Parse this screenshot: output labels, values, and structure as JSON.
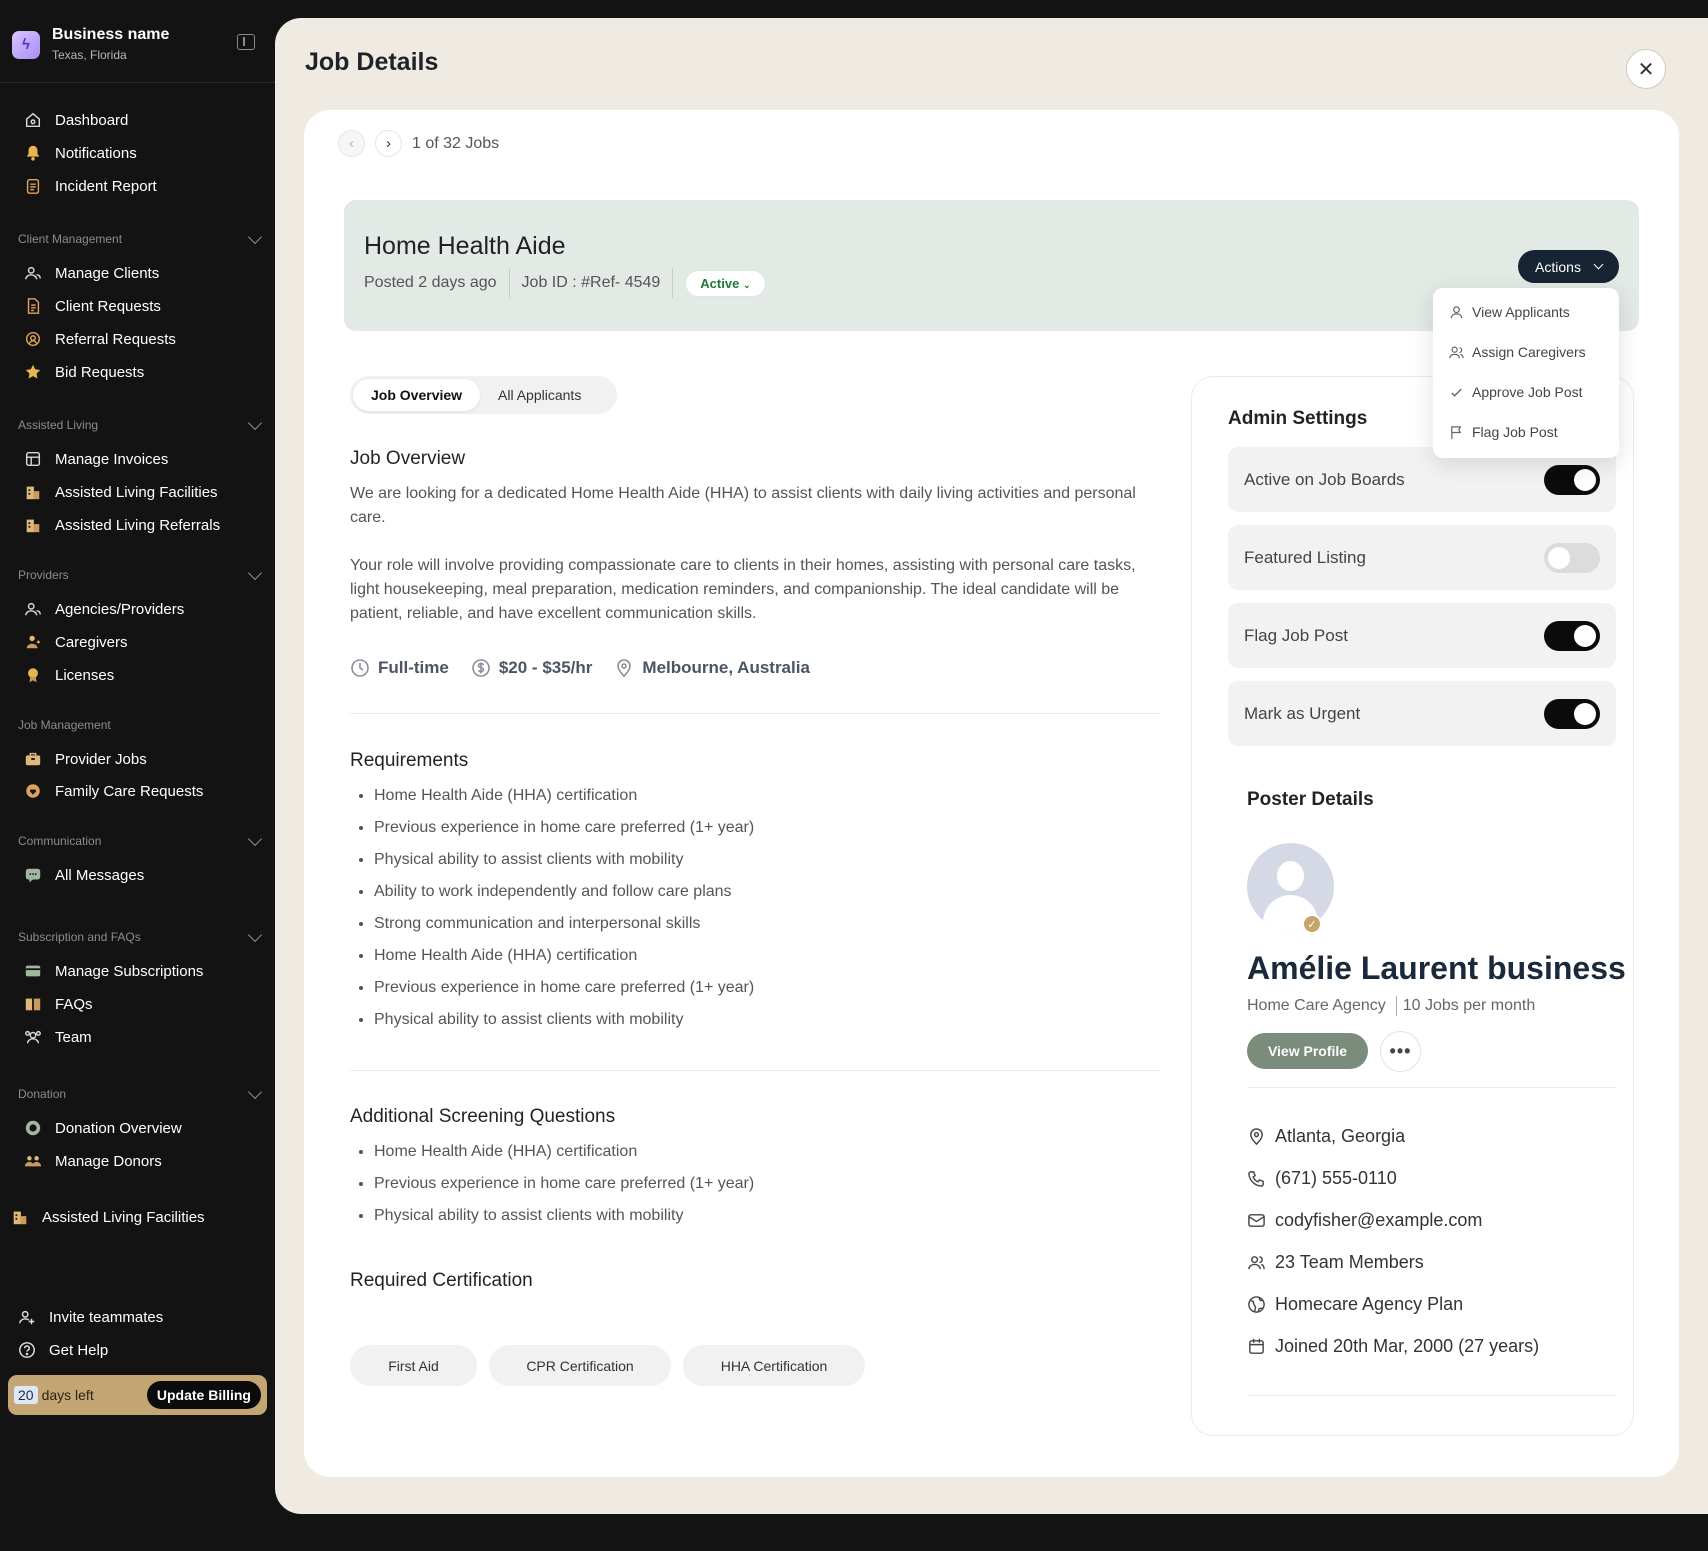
{
  "business": {
    "name": "Business name",
    "location": "Texas, Florida"
  },
  "nav": {
    "top": [
      "Dashboard",
      "Notifications",
      "Incident Report"
    ],
    "sections": [
      {
        "title": "Client Management",
        "items": [
          "Manage Clients",
          "Client Requests",
          "Referral Requests",
          "Bid Requests"
        ]
      },
      {
        "title": "Assisted Living",
        "items": [
          "Manage Invoices",
          "Assisted Living Facilities",
          "Assisted Living Referrals"
        ]
      },
      {
        "title": "Providers",
        "items": [
          "Agencies/Providers",
          "Caregivers",
          "Licenses"
        ]
      },
      {
        "title": "Job Management",
        "items": [
          "Provider Jobs",
          "Family Care Requests"
        ]
      },
      {
        "title": "Communication",
        "items": [
          "All Messages"
        ]
      },
      {
        "title": "Subscription and FAQs",
        "items": [
          "Manage Subscriptions",
          "FAQs",
          "Team"
        ]
      },
      {
        "title": "Donation",
        "items": [
          "Donation Overview",
          "Manage Donors"
        ]
      }
    ],
    "extra_item": "Assisted Living Facilities",
    "invite": "Invite teammates",
    "help": "Get Help"
  },
  "billing": {
    "days": "20",
    "days_label": "days left",
    "button": "Update Billing"
  },
  "page": {
    "title": "Job Details"
  },
  "pager": {
    "text": "1 of 32 Jobs"
  },
  "job": {
    "title": "Home Health Aide",
    "posted": "Posted 2 days ago",
    "job_id": "Job ID : #Ref- 4549",
    "status": "Active",
    "actions_label": "Actions"
  },
  "actions_menu": [
    "View Applicants",
    "Assign Caregivers",
    "Approve Job Post",
    "Flag Job Post"
  ],
  "tabs": [
    "Job Overview",
    "All Applicants"
  ],
  "overview": {
    "title": "Job Overview",
    "p1": "We are looking for a dedicated Home Health Aide (HHA) to assist clients with daily living activities and personal care.",
    "p2": "Your role will involve providing compassionate care to clients in their homes, assisting with personal care tasks, light housekeeping, meal preparation, medication reminders, and companionship. The ideal candidate will be patient, reliable, and have excellent communication skills.",
    "type": "Full-time",
    "pay": "$20 - $35/hr",
    "location": "Melbourne, Australia"
  },
  "requirements": {
    "title": "Requirements",
    "items": [
      "Home Health Aide (HHA) certification",
      "Previous experience in home care preferred (1+ year)",
      "Physical ability to assist clients with mobility",
      "Ability to work independently and follow care plans",
      "Strong communication and interpersonal skills",
      "Home Health Aide (HHA) certification",
      "Previous experience in home care preferred (1+ year)",
      "Physical ability to assist clients with mobility"
    ]
  },
  "screening": {
    "title": "Additional Screening Questions",
    "items": [
      "Home Health Aide (HHA) certification",
      "Previous experience in home care preferred (1+ year)",
      "Physical ability to assist clients with mobility"
    ]
  },
  "certification": {
    "title": "Required Certification",
    "items": [
      "First Aid",
      "CPR Certification",
      "HHA Certification"
    ]
  },
  "admin": {
    "title": "Admin Settings",
    "toggles": [
      {
        "label": "Active on Job Boards",
        "on": true
      },
      {
        "label": "Featured Listing",
        "on": false
      },
      {
        "label": "Flag Job Post",
        "on": true
      },
      {
        "label": "Mark as Urgent",
        "on": true
      }
    ]
  },
  "poster": {
    "title": "Poster Details",
    "name": "Amélie Laurent business",
    "type": "Home Care Agency",
    "jobs": "10 Jobs per month",
    "view_profile": "View Profile",
    "location": "Atlanta, Georgia",
    "phone": "(671) 555-0110",
    "email": "codyfisher@example.com",
    "team": "23 Team Members",
    "plan": "Homecare Agency Plan",
    "joined": "Joined 20th Mar, 2000 (27 years)"
  },
  "colors": {
    "sidebar_bg": "#131313",
    "panel_bg": "#efebe2",
    "hero_bg": "#e3e9e4",
    "accent_dark": "#172434",
    "billing": "#c4a574",
    "status_green": "#1c7a3a"
  }
}
